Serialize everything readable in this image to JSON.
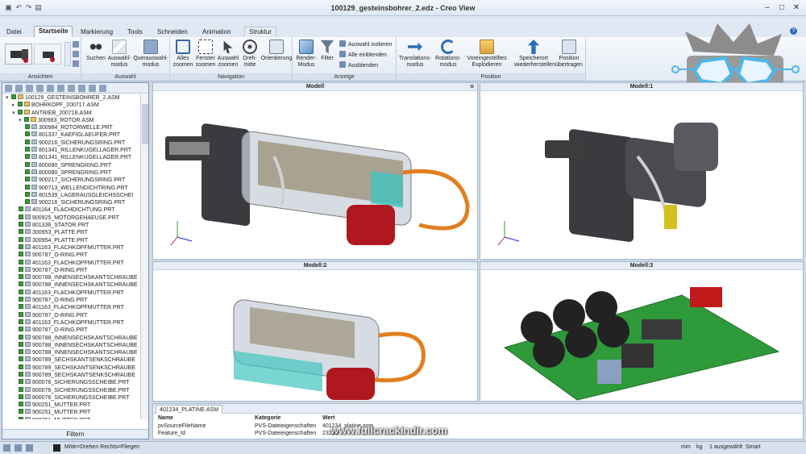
{
  "app": {
    "title": "100129_gesteinsbohrer_2.edz - Creo View"
  },
  "tabs": [
    "Datei",
    "Startseite",
    "Markierung",
    "Tools",
    "Schneiden",
    "Animation",
    "Struktur"
  ],
  "ribbon": {
    "groups": [
      "Ansichten",
      "Auswahl",
      "Navigation",
      "Anzeige",
      "Position"
    ],
    "buttons": {
      "suchen": "Suchen",
      "auswahlmodus": "Auswahl-\nmodus",
      "querauswahlmodus": "Querauswahl-\nmodus",
      "alles_zoomen": "Alles\nzoomen",
      "fenster_zoomen": "Fenster\nzoomen",
      "auswahl_zoomen": "Auswahl\nzoomen",
      "drehmitte": "Dreh-\nmitte",
      "orientierung": "Orientierung",
      "render_modus": "Render-\nModus",
      "filter": "Filter",
      "auswahl_isolieren": "Auswahl isolieren",
      "alle_einblenden": "Alle einblenden",
      "ausblenden": "Ausblenden",
      "translationsmodus": "Translations-\nmodus",
      "rotationsmodus": "Rotations-\nmodus",
      "voreingestellte": "Voreingestelltes\nExplodieren",
      "speicherort": "Speicherort\nwiederherstellen",
      "position_uebertragen": "Position\nübertragen"
    }
  },
  "tree": {
    "items": [
      {
        "level": 0,
        "type": "asm",
        "label": "100129_GESTEINSBOHRER_2.ASM"
      },
      {
        "level": 1,
        "type": "asm",
        "label": "BOHRKOPF_200717.ASM"
      },
      {
        "level": 1,
        "type": "asm",
        "label": "ANTRIEB_200718.ASM"
      },
      {
        "level": 2,
        "type": "asm",
        "label": "300983_ROTOR.ASM"
      },
      {
        "level": 3,
        "type": "prt",
        "label": "300984_ROTORWELLE.PRT"
      },
      {
        "level": 3,
        "type": "prt",
        "label": "801337_KAEFIGLAEUFER.PRT"
      },
      {
        "level": 3,
        "type": "prt",
        "label": "900216_SICHERUNGSRING.PRT"
      },
      {
        "level": 3,
        "type": "prt",
        "label": "801341_RILLENKUGELLAGER.PRT"
      },
      {
        "level": 3,
        "type": "prt",
        "label": "801341_RILLENKUGELLAGER.PRT"
      },
      {
        "level": 3,
        "type": "prt",
        "label": "800080_SPRENGRING.PRT"
      },
      {
        "level": 3,
        "type": "prt",
        "label": "800080_SPRENGRING.PRT"
      },
      {
        "level": 3,
        "type": "prt",
        "label": "900217_SICHERUNGSRING.PRT"
      },
      {
        "level": 3,
        "type": "prt",
        "label": "900713_WELLENDICHTRING.PRT"
      },
      {
        "level": 3,
        "type": "prt",
        "label": "801539_LAGERAUSGLEICHSSCHEI"
      },
      {
        "level": 3,
        "type": "prt",
        "label": "900216_SICHERUNGSRING.PRT"
      },
      {
        "level": 2,
        "type": "prt",
        "label": "401164_FLACHDICHTUNG.PRT"
      },
      {
        "level": 2,
        "type": "prt",
        "label": "900925_MOTORGEHAEUSE.PRT"
      },
      {
        "level": 2,
        "type": "prt",
        "label": "801336_STATOR.PRT"
      },
      {
        "level": 2,
        "type": "prt",
        "label": "300953_PLATTE.PRT"
      },
      {
        "level": 2,
        "type": "prt",
        "label": "300954_PLATTE.PRT"
      },
      {
        "level": 2,
        "type": "prt",
        "label": "401163_FLACHKOPFMUTTER.PRT"
      },
      {
        "level": 2,
        "type": "prt",
        "label": "900787_O-RING.PRT"
      },
      {
        "level": 2,
        "type": "prt",
        "label": "401163_FLACHKOPFMUTTER.PRT"
      },
      {
        "level": 2,
        "type": "prt",
        "label": "900787_O-RING.PRT"
      },
      {
        "level": 2,
        "type": "prt",
        "label": "900788_INNENSECHSKANTSCHRAUBE"
      },
      {
        "level": 2,
        "type": "prt",
        "label": "900788_INNENSECHSKANTSCHRAUBE"
      },
      {
        "level": 2,
        "type": "prt",
        "label": "401163_FLACHKOPFMUTTER.PRT"
      },
      {
        "level": 2,
        "type": "prt",
        "label": "900787_O-RING.PRT"
      },
      {
        "level": 2,
        "type": "prt",
        "label": "401163_FLACHKOPFMUTTER.PRT"
      },
      {
        "level": 2,
        "type": "prt",
        "label": "900787_O-RING.PRT"
      },
      {
        "level": 2,
        "type": "prt",
        "label": "401163_FLACHKOPFMUTTER.PRT"
      },
      {
        "level": 2,
        "type": "prt",
        "label": "900787_O-RING.PRT"
      },
      {
        "level": 2,
        "type": "prt",
        "label": "900788_INNENSECHSKANTSCHRAUBE"
      },
      {
        "level": 2,
        "type": "prt",
        "label": "900788_INNENSECHSKANTSCHRAUBE"
      },
      {
        "level": 2,
        "type": "prt",
        "label": "900788_INNENSECHSKANTSCHRAUBE"
      },
      {
        "level": 2,
        "type": "prt",
        "label": "900789_SECHSKANTSENKSCHRAUBE"
      },
      {
        "level": 2,
        "type": "prt",
        "label": "900789_SECHSKANTSENKSCHRAUBE"
      },
      {
        "level": 2,
        "type": "prt",
        "label": "900789_SECHSKANTSENKSCHRAUBE"
      },
      {
        "level": 2,
        "type": "prt",
        "label": "800076_SICHERUNGSSCHEIBE.PRT"
      },
      {
        "level": 2,
        "type": "prt",
        "label": "800076_SICHERUNGSSCHEIBE.PRT"
      },
      {
        "level": 2,
        "type": "prt",
        "label": "800076_SICHERUNGSSCHEIBE.PRT"
      },
      {
        "level": 2,
        "type": "prt",
        "label": "900251_MUTTER.PRT"
      },
      {
        "level": 2,
        "type": "prt",
        "label": "900251_MUTTER.PRT"
      },
      {
        "level": 2,
        "type": "prt",
        "label": "900251_MUTTER.PRT"
      }
    ],
    "filter_label": "Filtern"
  },
  "viewports": [
    "Modell",
    "Modell:1",
    "Modell:2",
    "Modell:3"
  ],
  "bottom": {
    "tab": "401234_PLATINE.ASM",
    "headers": [
      "Name",
      "Kategorie",
      "Wert"
    ],
    "rows": [
      [
        "pvSourceFileName",
        "PVS-Dateieigenschaften",
        "401234_platine.asm"
      ],
      [
        "Feature_Id",
        "PVS-Dateieigenschaften",
        "23289"
      ]
    ]
  },
  "status": {
    "mode": "Mitte=Drehen   Rechts=Fliegen",
    "units_len": "mm",
    "units_mass": "kg",
    "selected": "1 ausgewählt",
    "smart": "Smart"
  },
  "watermark": "www.fullcrackindir.com",
  "colors": {
    "accent": "#2b579a",
    "tree_check": "#3c9a3c",
    "pcb_green": "#2e9a3a",
    "plug_red": "#b01820",
    "cable_orange": "#e08020"
  }
}
